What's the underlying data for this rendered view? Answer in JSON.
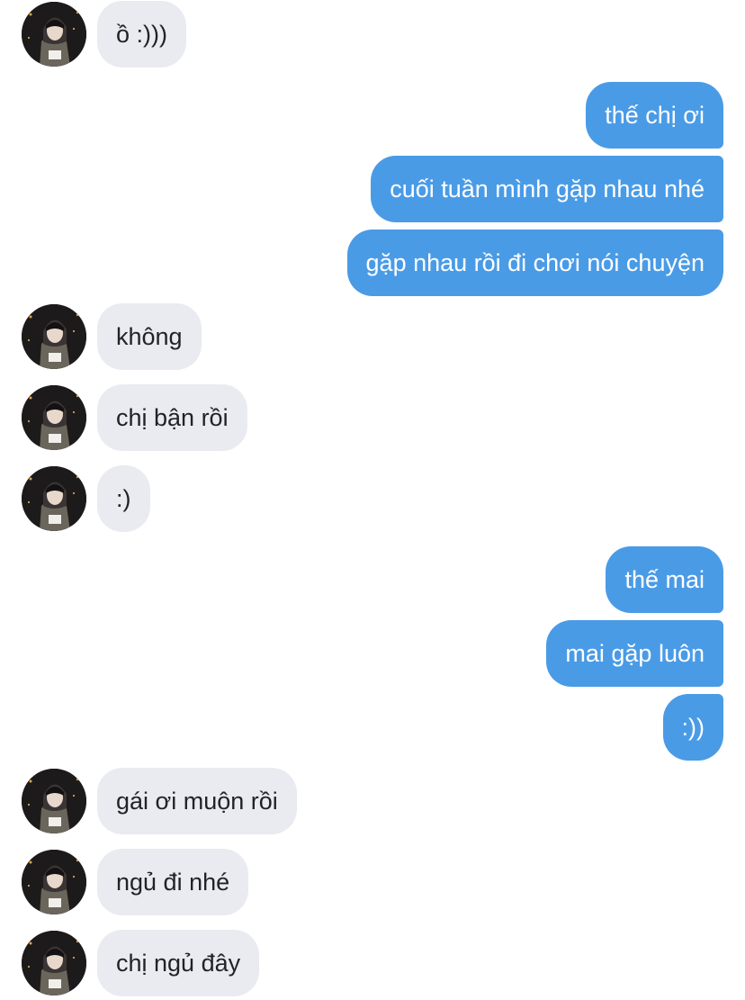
{
  "conversation": {
    "messages": [
      {
        "side": "in",
        "text": "ồ :)))",
        "avatar": "profile-avatar"
      },
      {
        "side": "out",
        "text": "thế chị ơi"
      },
      {
        "side": "out",
        "text": "cuối tuần mình gặp nhau nhé"
      },
      {
        "side": "out",
        "text": "gặp nhau rồi đi chơi nói chuyện"
      },
      {
        "side": "in",
        "text": "không",
        "avatar": "profile-avatar"
      },
      {
        "side": "in",
        "text": "chị bận rồi",
        "avatar": "profile-avatar"
      },
      {
        "side": "in",
        "text": ":)",
        "avatar": "profile-avatar"
      },
      {
        "side": "out",
        "text": "thế mai"
      },
      {
        "side": "out",
        "text": "mai gặp luôn"
      },
      {
        "side": "out",
        "text": ":))"
      },
      {
        "side": "in",
        "text": "gái ơi muộn rồi",
        "avatar": "profile-avatar"
      },
      {
        "side": "in",
        "text": "ngủ đi nhé",
        "avatar": "profile-avatar"
      },
      {
        "side": "in",
        "text": "chị ngủ đây",
        "avatar": "profile-avatar"
      }
    ]
  },
  "colors": {
    "incoming_bubble": "#e9ebf0",
    "incoming_text": "#1f2329",
    "outgoing_bubble": "#4a9be6",
    "outgoing_text": "#ffffff"
  }
}
